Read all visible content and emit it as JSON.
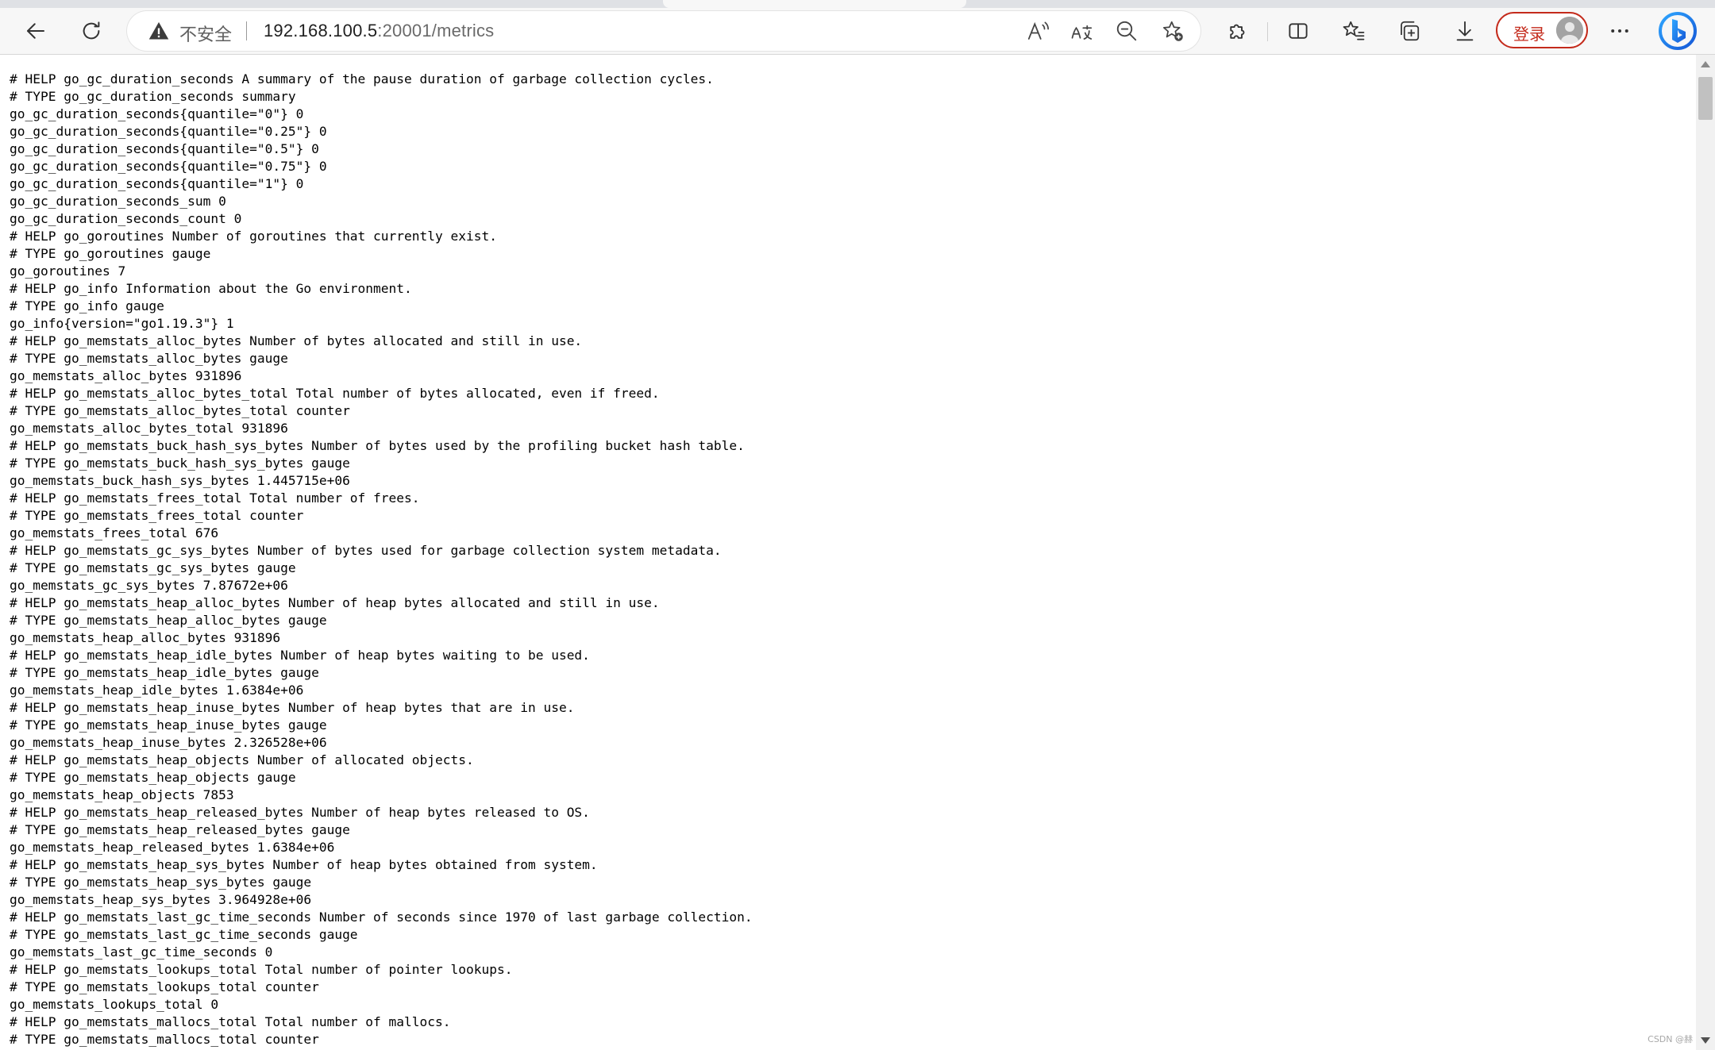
{
  "browser": {
    "security_label": "不安全",
    "url_host": "192.168.100.5",
    "url_rest": ":20001/metrics",
    "login_label": "登录",
    "colors": {
      "login_accent": "#c42b1c",
      "bing_blue": "#1a73e8"
    }
  },
  "icons": {
    "back": "arrow-left",
    "refresh": "refresh",
    "warning": "warning-triangle",
    "read_aloud": "read-aloud",
    "translate": "translate",
    "zoom_out": "zoom-out",
    "favorite_add": "star-plus",
    "extensions": "puzzle",
    "split_screen": "split-screen",
    "favorites": "star-list",
    "collections": "collections",
    "downloads": "download",
    "more": "ellipsis",
    "copilot": "bing"
  },
  "metrics_lines": [
    "# HELP go_gc_duration_seconds A summary of the pause duration of garbage collection cycles.",
    "# TYPE go_gc_duration_seconds summary",
    "go_gc_duration_seconds{quantile=\"0\"} 0",
    "go_gc_duration_seconds{quantile=\"0.25\"} 0",
    "go_gc_duration_seconds{quantile=\"0.5\"} 0",
    "go_gc_duration_seconds{quantile=\"0.75\"} 0",
    "go_gc_duration_seconds{quantile=\"1\"} 0",
    "go_gc_duration_seconds_sum 0",
    "go_gc_duration_seconds_count 0",
    "# HELP go_goroutines Number of goroutines that currently exist.",
    "# TYPE go_goroutines gauge",
    "go_goroutines 7",
    "# HELP go_info Information about the Go environment.",
    "# TYPE go_info gauge",
    "go_info{version=\"go1.19.3\"} 1",
    "# HELP go_memstats_alloc_bytes Number of bytes allocated and still in use.",
    "# TYPE go_memstats_alloc_bytes gauge",
    "go_memstats_alloc_bytes 931896",
    "# HELP go_memstats_alloc_bytes_total Total number of bytes allocated, even if freed.",
    "# TYPE go_memstats_alloc_bytes_total counter",
    "go_memstats_alloc_bytes_total 931896",
    "# HELP go_memstats_buck_hash_sys_bytes Number of bytes used by the profiling bucket hash table.",
    "# TYPE go_memstats_buck_hash_sys_bytes gauge",
    "go_memstats_buck_hash_sys_bytes 1.445715e+06",
    "# HELP go_memstats_frees_total Total number of frees.",
    "# TYPE go_memstats_frees_total counter",
    "go_memstats_frees_total 676",
    "# HELP go_memstats_gc_sys_bytes Number of bytes used for garbage collection system metadata.",
    "# TYPE go_memstats_gc_sys_bytes gauge",
    "go_memstats_gc_sys_bytes 7.87672e+06",
    "# HELP go_memstats_heap_alloc_bytes Number of heap bytes allocated and still in use.",
    "# TYPE go_memstats_heap_alloc_bytes gauge",
    "go_memstats_heap_alloc_bytes 931896",
    "# HELP go_memstats_heap_idle_bytes Number of heap bytes waiting to be used.",
    "# TYPE go_memstats_heap_idle_bytes gauge",
    "go_memstats_heap_idle_bytes 1.6384e+06",
    "# HELP go_memstats_heap_inuse_bytes Number of heap bytes that are in use.",
    "# TYPE go_memstats_heap_inuse_bytes gauge",
    "go_memstats_heap_inuse_bytes 2.326528e+06",
    "# HELP go_memstats_heap_objects Number of allocated objects.",
    "# TYPE go_memstats_heap_objects gauge",
    "go_memstats_heap_objects 7853",
    "# HELP go_memstats_heap_released_bytes Number of heap bytes released to OS.",
    "# TYPE go_memstats_heap_released_bytes gauge",
    "go_memstats_heap_released_bytes 1.6384e+06",
    "# HELP go_memstats_heap_sys_bytes Number of heap bytes obtained from system.",
    "# TYPE go_memstats_heap_sys_bytes gauge",
    "go_memstats_heap_sys_bytes 3.964928e+06",
    "# HELP go_memstats_last_gc_time_seconds Number of seconds since 1970 of last garbage collection.",
    "# TYPE go_memstats_last_gc_time_seconds gauge",
    "go_memstats_last_gc_time_seconds 0",
    "# HELP go_memstats_lookups_total Total number of pointer lookups.",
    "# TYPE go_memstats_lookups_total counter",
    "go_memstats_lookups_total 0",
    "# HELP go_memstats_mallocs_total Total number of mallocs.",
    "# TYPE go_memstats_mallocs_total counter"
  ],
  "watermark": "CSDN @赫"
}
